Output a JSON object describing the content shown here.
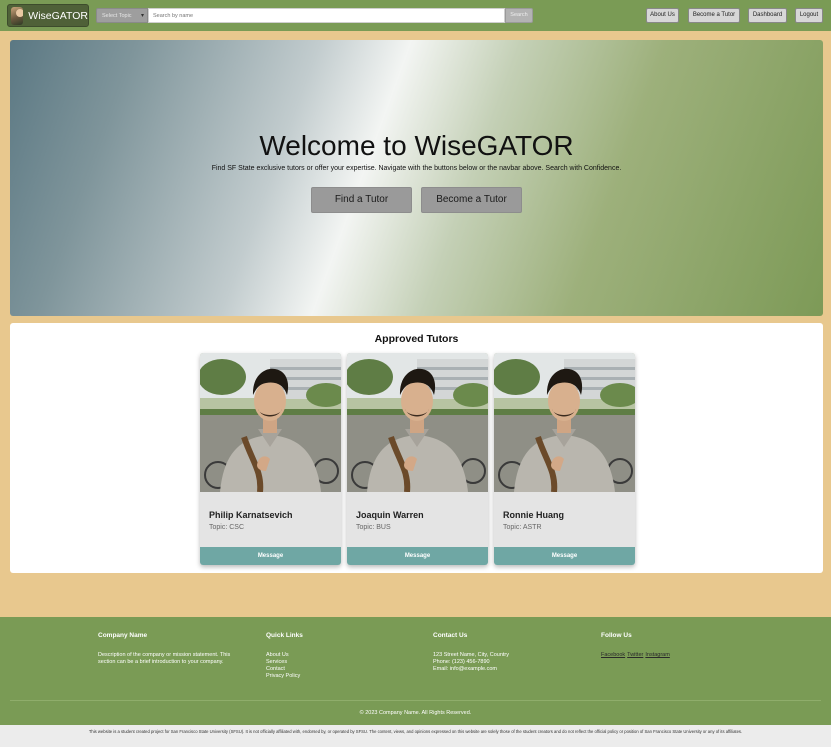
{
  "navbar": {
    "brand": "WiseGATOR",
    "topic_select": "Select Topic",
    "search_placeholder": "Search by name",
    "search_button": "Search",
    "links": [
      "About Us",
      "Become a Tutor",
      "Dashboard",
      "Logout"
    ]
  },
  "hero": {
    "title": "Welcome to WiseGATOR",
    "subtitle": "Find SF State exclusive tutors or offer your expertise. Navigate with the buttons below or the navbar above. Search with Confidence.",
    "find_button": "Find a Tutor",
    "become_button": "Become a Tutor"
  },
  "tutors": {
    "title": "Approved Tutors",
    "items": [
      {
        "name": "Philip Karnatsevich",
        "topic": "Topic: CSC",
        "button": "Message"
      },
      {
        "name": "Joaquin Warren",
        "topic": "Topic: BUS",
        "button": "Message"
      },
      {
        "name": "Ronnie Huang",
        "topic": "Topic: ASTR",
        "button": "Message"
      }
    ]
  },
  "footer": {
    "company": {
      "heading": "Company Name",
      "text": "Description of the company or mission statement. This section can be a brief introduction to your company."
    },
    "quick_links": {
      "heading": "Quick Links",
      "items": [
        "About Us",
        "Services",
        "Contact",
        "Privacy Policy"
      ]
    },
    "contact": {
      "heading": "Contact Us",
      "address": "123 Street Name, City, Country",
      "phone": "Phone: (123) 456-7890",
      "email": "Email: info@example.com"
    },
    "follow": {
      "heading": "Follow Us",
      "items": [
        "Facebook",
        "Twitter",
        "Instagram"
      ]
    },
    "copyright": "© 2023 Company Name. All Rights Reserved."
  },
  "disclaimer": "This website is a student created project for San Francisco State University (SFSU). It is not officially affiliated with, endorsed by, or operated by SFSU. The content, views, and opinions expressed on this website are solely those of the student creators and do not reflect the official policy or position of San Francisco State University or any of its affiliates.",
  "colors": {
    "navbar": "#7a9b55",
    "page_background": "#e8c88e",
    "message_button": "#6fa7a4"
  }
}
